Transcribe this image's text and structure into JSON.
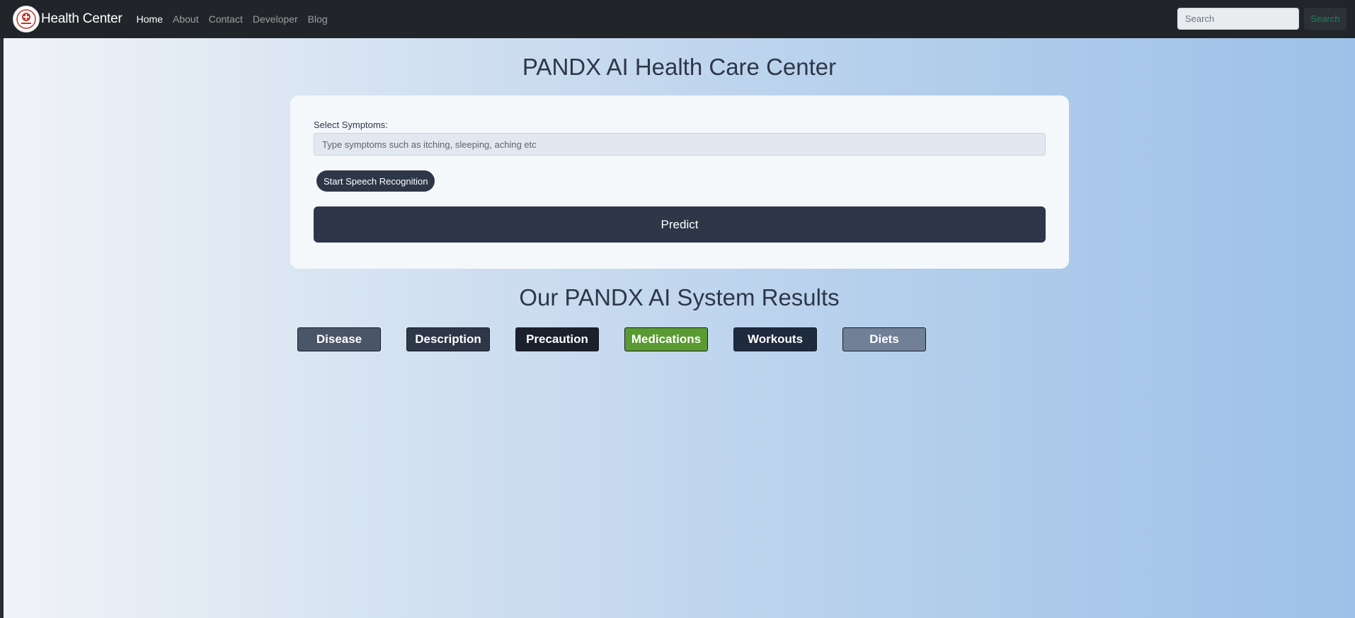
{
  "navbar": {
    "brand": "Health Center",
    "links": [
      {
        "label": "Home",
        "active": true
      },
      {
        "label": "About",
        "active": false
      },
      {
        "label": "Contact",
        "active": false
      },
      {
        "label": "Developer",
        "active": false
      },
      {
        "label": "Blog",
        "active": false
      }
    ],
    "search_placeholder": "Search",
    "search_button": "Search"
  },
  "main": {
    "title": "PANDX AI Health Care Center",
    "form": {
      "label": "Select Symptoms:",
      "input_placeholder": "Type symptoms such as itching, sleeping, aching etc",
      "input_value": "",
      "speech_button": "Start Speech Recognition",
      "predict_button": "Predict"
    },
    "results_title": "Our PANDX AI System Results",
    "result_buttons": [
      {
        "label": "Disease",
        "color": "#4a5568"
      },
      {
        "label": "Description",
        "color": "#2d3748"
      },
      {
        "label": "Precaution",
        "color": "#1a202c"
      },
      {
        "label": "Medications",
        "color": "#5a9a33"
      },
      {
        "label": "Workouts",
        "color": "#1e2a3e"
      },
      {
        "label": "Diets",
        "color": "#718096"
      }
    ]
  },
  "colors": {
    "navbar_bg": "#212529",
    "primary_dark": "#2d3748",
    "search_text": "#198754"
  }
}
